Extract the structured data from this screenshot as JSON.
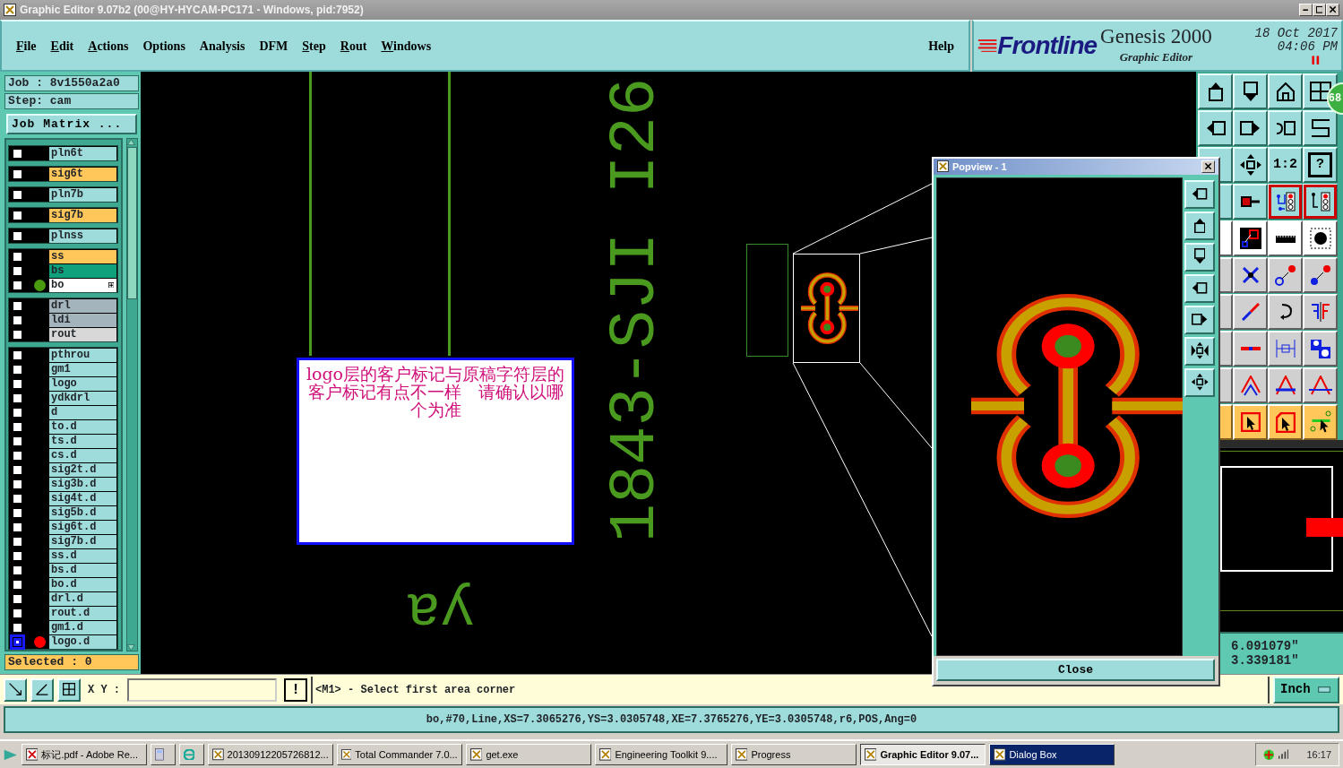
{
  "window": {
    "title": "Graphic Editor 9.07b2 (00@HY-HYCAM-PC171 - Windows, pid:7952)"
  },
  "menu": [
    {
      "label": "File",
      "mnemonic": true
    },
    {
      "label": "Edit",
      "mnemonic": true
    },
    {
      "label": "Actions",
      "mnemonic": true
    },
    {
      "label": "Options",
      "mnemonic": false
    },
    {
      "label": "Analysis",
      "mnemonic": false
    },
    {
      "label": "DFM",
      "mnemonic": false
    },
    {
      "label": "Step",
      "mnemonic": true
    },
    {
      "label": "Rout",
      "mnemonic": true
    },
    {
      "label": "Windows",
      "mnemonic": true
    }
  ],
  "help": "Help",
  "brand": {
    "logo": "Frontline",
    "product": "Genesis 2000",
    "subtitle": "Graphic Editor",
    "date": "18 Oct 2017",
    "time": "04:06 PM"
  },
  "job": {
    "job": "Job : 8v1550a2a0",
    "step": "Step: cam",
    "matrix_button": "Job Matrix ..."
  },
  "layer_groups": [
    [
      {
        "name": "pln6t",
        "kind": "power",
        "selected": false,
        "expandable": false
      }
    ],
    [
      {
        "name": "sig6t",
        "kind": "signal",
        "selected": false,
        "expandable": false
      }
    ],
    [
      {
        "name": "pln7b",
        "kind": "power",
        "selected": false,
        "expandable": false
      }
    ],
    [
      {
        "name": "sig7b",
        "kind": "signal",
        "selected": false,
        "expandable": false
      }
    ],
    [
      {
        "name": "plnss",
        "kind": "power",
        "selected": false,
        "expandable": false
      }
    ],
    [
      {
        "name": "ss",
        "kind": "silkscreen",
        "selected": false,
        "expandable": false
      },
      {
        "name": "bs",
        "kind": "mask",
        "selected": false,
        "expandable": false
      },
      {
        "name": "bo",
        "kind": "work",
        "color": "#4a9a10",
        "selected": false,
        "expandable": true
      }
    ],
    [
      {
        "name": "drl",
        "kind": "drill",
        "selected": false,
        "expandable": false
      },
      {
        "name": "ldi",
        "kind": "drill",
        "selected": false,
        "expandable": false
      },
      {
        "name": "rout",
        "kind": "rout",
        "selected": false,
        "expandable": false
      }
    ],
    [
      {
        "name": "pthrou",
        "kind": "misc",
        "selected": false,
        "expandable": false
      },
      {
        "name": "gm1",
        "kind": "misc",
        "selected": false,
        "expandable": false
      },
      {
        "name": "logo",
        "kind": "misc",
        "selected": false,
        "expandable": false
      },
      {
        "name": "ydkdrl",
        "kind": "misc",
        "selected": false,
        "expandable": false
      },
      {
        "name": "d",
        "kind": "misc",
        "selected": false,
        "expandable": false
      },
      {
        "name": "to.d",
        "kind": "misc",
        "selected": false,
        "expandable": false
      },
      {
        "name": "ts.d",
        "kind": "misc",
        "selected": false,
        "expandable": false
      },
      {
        "name": "cs.d",
        "kind": "misc",
        "selected": false,
        "expandable": false
      },
      {
        "name": "sig2t.d",
        "kind": "misc",
        "selected": false,
        "expandable": false
      },
      {
        "name": "sig3b.d",
        "kind": "misc",
        "selected": false,
        "expandable": false
      },
      {
        "name": "sig4t.d",
        "kind": "misc",
        "selected": false,
        "expandable": false
      },
      {
        "name": "sig5b.d",
        "kind": "misc",
        "selected": false,
        "expandable": false
      },
      {
        "name": "sig6t.d",
        "kind": "misc",
        "selected": false,
        "expandable": false
      },
      {
        "name": "sig7b.d",
        "kind": "misc",
        "selected": false,
        "expandable": false
      },
      {
        "name": "ss.d",
        "kind": "misc",
        "selected": false,
        "expandable": false
      },
      {
        "name": "bs.d",
        "kind": "misc",
        "selected": false,
        "expandable": false
      },
      {
        "name": "bo.d",
        "kind": "misc",
        "selected": false,
        "expandable": false
      },
      {
        "name": "drl.d",
        "kind": "misc",
        "selected": false,
        "expandable": false
      },
      {
        "name": "rout.d",
        "kind": "misc",
        "selected": false,
        "expandable": false
      },
      {
        "name": "gm1.d",
        "kind": "misc",
        "selected": false,
        "expandable": false
      },
      {
        "name": "logo.d",
        "kind": "misc",
        "color": "#ff0000",
        "selected": true,
        "expandable": false
      }
    ]
  ],
  "selected_count": "Selected : 0",
  "canvas": {
    "board_text": "1843-SJI I26",
    "mark_text": "ya",
    "note": "logo层的客户标记与原稿字符层的客户标记有点不一样　请确认以哪个为准"
  },
  "toolbar_texts": [
    "1:2",
    "?"
  ],
  "badge": "68",
  "coordinates": [
    "6.091079\"",
    "3.339181\""
  ],
  "popview": {
    "title": "Popview - 1",
    "close": "Close"
  },
  "command": {
    "xy_label": "X Y :",
    "confirm": "!",
    "prompt": "<M1> - Select first area corner",
    "units": "Inch"
  },
  "status": "bo,#70,Line,XS=7.3065276,YS=3.0305748,XE=7.3765276,YE=3.0305748,r6,POS,Ang=0",
  "taskbar": {
    "items": [
      {
        "kind": "app",
        "label": "标记.pdf - Adobe Re...",
        "pressed": false,
        "active": false
      },
      {
        "kind": "icon",
        "pressed": false,
        "active": false
      },
      {
        "kind": "icon",
        "pressed": false,
        "active": false
      },
      {
        "kind": "app",
        "label": "20130912205726812...",
        "pressed": false,
        "active": false
      },
      {
        "kind": "app",
        "label": "Total Commander 7.0...",
        "pressed": false,
        "active": false
      },
      {
        "kind": "app",
        "label": "get.exe",
        "pressed": false,
        "active": false
      },
      {
        "kind": "app",
        "label": "Engineering Toolkit 9....",
        "pressed": false,
        "active": false
      },
      {
        "kind": "app",
        "label": "Progress",
        "pressed": false,
        "active": false
      },
      {
        "kind": "app",
        "label": "Graphic Editor 9.07...",
        "pressed": true,
        "active": false
      },
      {
        "kind": "app",
        "label": "Dialog Box",
        "pressed": false,
        "active": true
      }
    ],
    "clock": "16:17"
  }
}
